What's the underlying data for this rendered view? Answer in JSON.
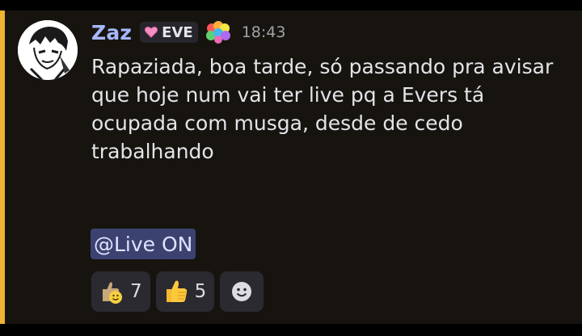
{
  "message": {
    "username": "Zaz",
    "role_tag": "EVE",
    "timestamp": "18:43",
    "content": "Rapaziada, boa tarde, só passando pra avisar que hoje num vai ter live pq a Evers tá ocupada com musga, desde de cedo trabalhando",
    "mention": "@Live ON",
    "icons": {
      "avatar": "manga-character-avatar",
      "tag_badge": "pink-heart-icon",
      "badge": "rainbow-sparkle-icon"
    }
  },
  "reactions": [
    {
      "icon": "thumbs-up-smiley-emoji",
      "count": "7"
    },
    {
      "icon": "thumbs-up-emoji",
      "count": "5"
    }
  ],
  "add_reaction": {
    "icon": "add-reaction-smiley-icon"
  },
  "colors": {
    "background": "#17140f",
    "mention_bar": "#f0b232",
    "username": "#a7b7ff",
    "mention_bg": "#3c4270",
    "reaction_bg": "#2b2a30"
  }
}
